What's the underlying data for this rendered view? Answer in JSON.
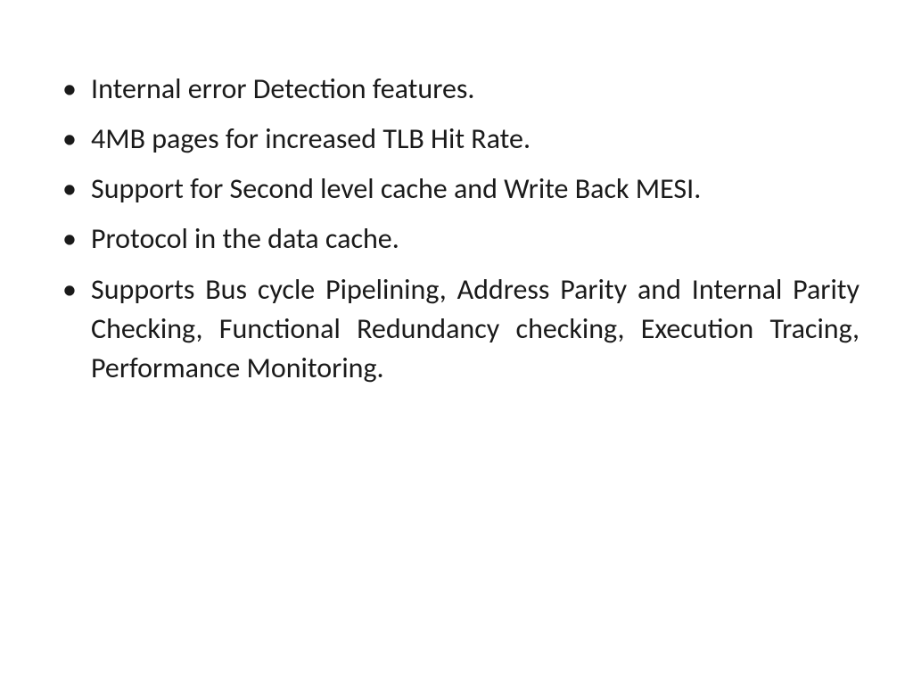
{
  "slide": {
    "bullets": [
      "Internal error Detection features.",
      "4MB pages for increased TLB Hit Rate.",
      "Support for Second level cache and Write Back MESI.",
      "Protocol in the data cache.",
      "Supports Bus cycle Pipelining, Address Parity and Internal Parity Checking, Functional Redundancy checking, Execution Tracing, Performance Monitoring."
    ]
  }
}
